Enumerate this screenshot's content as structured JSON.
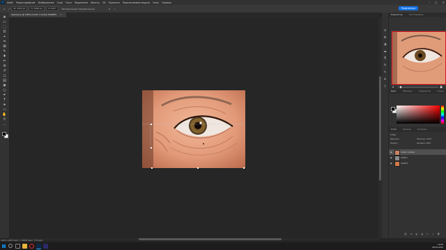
{
  "menubar": {
    "logo": "Ps",
    "items": [
      "Файл",
      "Редактирование",
      "Изображение",
      "Слои",
      "Текст",
      "Выделение",
      "Фильтр",
      "3D",
      "Просмотр",
      "Подключаемые модули",
      "Окно",
      "Справка"
    ],
    "window_controls": [
      "–",
      "□",
      "✕"
    ]
  },
  "options_bar": {
    "width_value": "W: 1253 px",
    "height_value": "H: 1000 px",
    "angle_value": "∠ 0,00°",
    "interpolation": "Интерполяция: Бикубическая",
    "share_label": "Поделиться"
  },
  "document": {
    "tab_title": "картинку @ 100% (Слой 1 копия, RGB/8*)",
    "close": "×",
    "status": "100%   1253 пикс. x 1000 пикс. (72 ppi)"
  },
  "tools": [
    "move-tool",
    "artboard-tool",
    "marquee-tool",
    "lasso-tool",
    "object-select-tool",
    "crop-tool",
    "frame-tool",
    "eyedropper-tool",
    "spot-healing-tool",
    "brush-tool",
    "clone-stamp-tool",
    "history-brush-tool",
    "eraser-tool",
    "gradient-tool",
    "blur-tool",
    "dodge-tool",
    "pen-tool",
    "type-tool",
    "path-select-tool",
    "rectangle-tool",
    "hand-tool",
    "zoom-tool",
    "more-tools"
  ],
  "tool_glyphs": [
    "✥",
    "▭",
    "⬚",
    "ʘ",
    "⌖",
    "⌗",
    "⊠",
    "✎",
    "✚",
    "✏",
    "⊛",
    "↺",
    "◻",
    "▤",
    "◉",
    "○",
    "✒",
    "T",
    "➤",
    "▭",
    "✋",
    "⚲",
    "…"
  ],
  "panels": {
    "navigator_tab": "Навигатор",
    "histogram_tab": "Гистограмма",
    "color_tab": "Цвет",
    "swatches_tab": "Образцы",
    "gradients_tab": "Градиенты",
    "patterns_tab": "Узоры",
    "layers_tab": "Слои",
    "channels_tab": "Каналы",
    "paths_tab": "Контуры",
    "kind_filter": "Q Вид",
    "blend_mode": "Обычные",
    "opacity_label": "Непрозр.: 100%",
    "lock_label": "Закреп.:",
    "fill_label": "Заливка: 100%",
    "zoom_level_fraction": 0.05,
    "layers": [
      {
        "name": "Слой 1 копия",
        "selected": true,
        "thumb": "#c98463"
      },
      {
        "name": "Слой 1",
        "selected": false,
        "thumb": "#8a8a8a"
      },
      {
        "name": "Слой 0",
        "selected": false,
        "thumb": "#d07a4c"
      }
    ],
    "footer_icons": [
      "link-icon",
      "fx-icon",
      "mask-icon",
      "adjustment-icon",
      "folder-icon",
      "new-layer-icon",
      "trash-icon"
    ],
    "footer_glyphs": [
      "⛓",
      "fx",
      "◐",
      "◑",
      "▭",
      "+",
      "🗑"
    ]
  },
  "iconstrip": [
    "history-icon",
    "properties-icon",
    "adjustments-icon",
    "libraries-icon",
    "paragraph-icon",
    "character-icon",
    "brush-settings-icon",
    "channels-icon",
    "paths-icon"
  ],
  "iconstrip_glyphs": [
    "↺",
    "⚙",
    "◑",
    "☁",
    "¶",
    "A",
    "✎",
    "≋",
    "◇"
  ],
  "taskbar": {
    "time": "10:05",
    "date": "28.06.2022"
  },
  "colors": {
    "accent": "#1473e6",
    "selection_box": "#e0101a",
    "ps_blue": "#31a8ff"
  }
}
